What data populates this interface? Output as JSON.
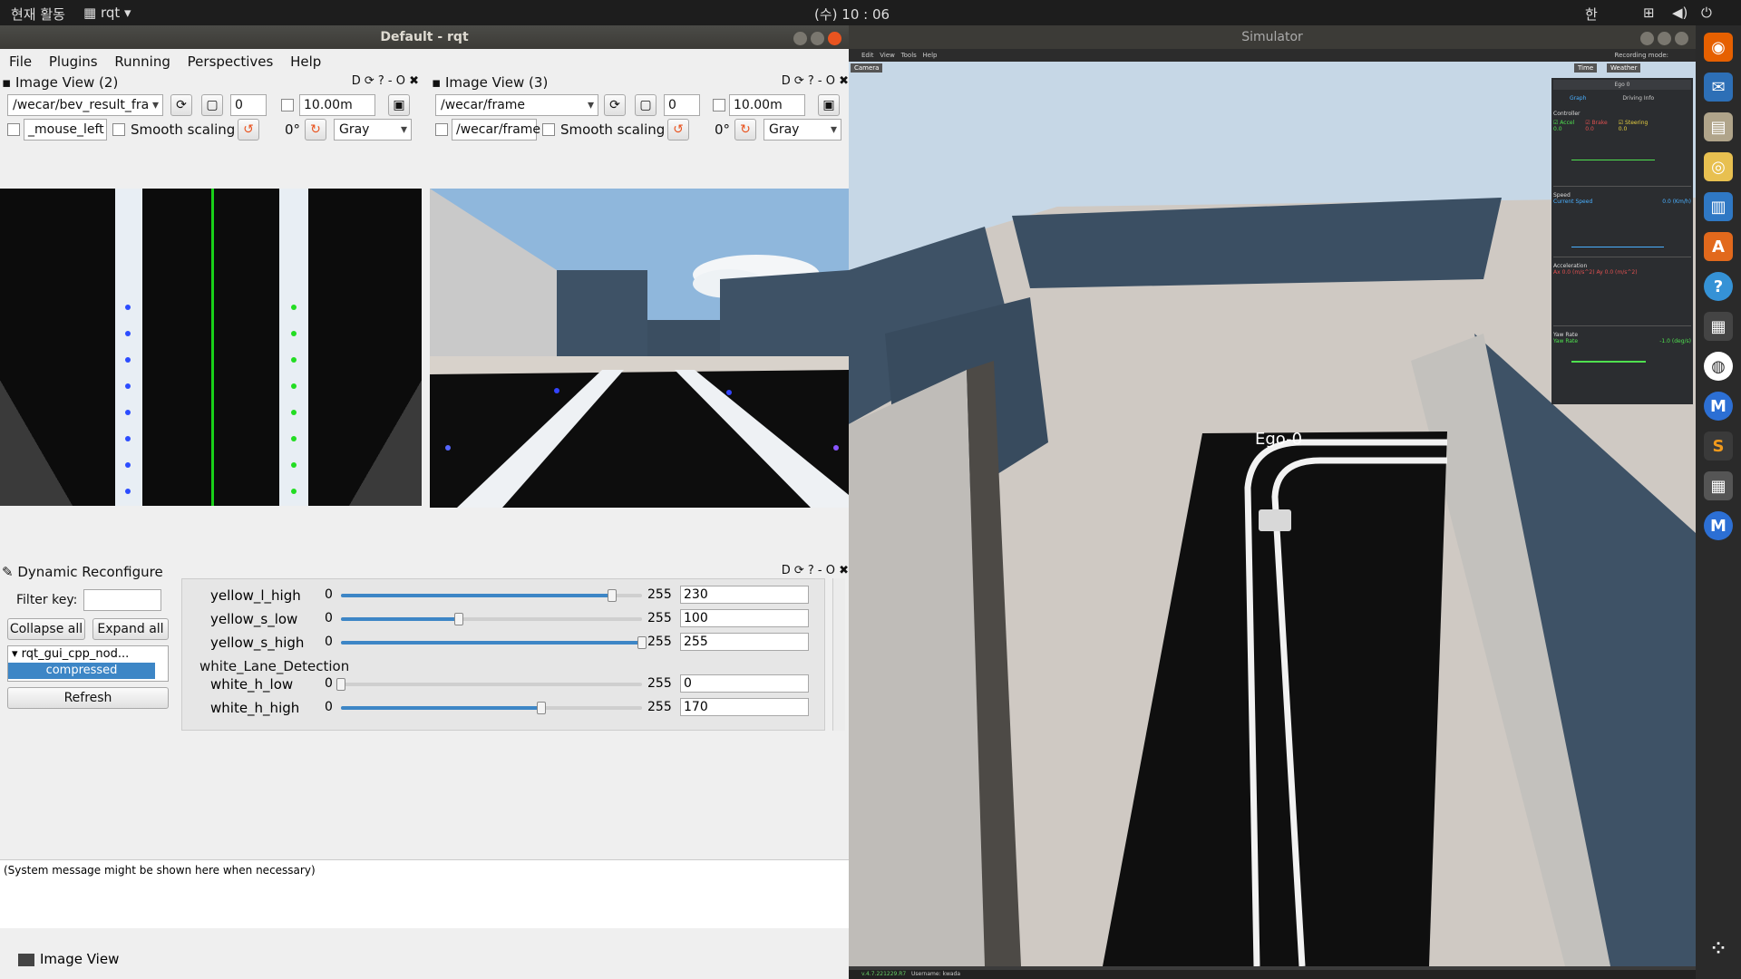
{
  "topbar": {
    "activities": "현재 활동",
    "app_menu": "rqt",
    "clock": "(수) 10 : 06",
    "input_method": "한"
  },
  "rqt_window": {
    "title": "Default - rqt",
    "menu": [
      "File",
      "Plugins",
      "Running",
      "Perspectives",
      "Help"
    ],
    "image_view_left": {
      "title": "Image View (2)",
      "tools": "D ⟳ ? - O ✖",
      "topic": "/wecar/bev_result_fra",
      "spin_value": "0",
      "distance": "10.00m",
      "mouse_topic": "_mouse_left",
      "smooth_label": "Smooth scaling",
      "rotation": "0°",
      "color_scheme": "Gray"
    },
    "image_view_right": {
      "title": "Image View (3)",
      "tools": "D ⟳ ? - O ✖",
      "topic": "/wecar/frame",
      "spin_value": "0",
      "distance": "10.00m",
      "mouse_topic": "/wecar/frame",
      "smooth_label": "Smooth scaling",
      "rotation": "0°",
      "color_scheme": "Gray"
    },
    "dynamic_reconfigure": {
      "title": "Dynamic Reconfigure",
      "tools": "D ⟳ ? - O ✖",
      "filter_label": "Filter key:",
      "collapse_all": "Collapse all",
      "expand_all": "Expand all",
      "tree_node": "rqt_gui_cpp_nod...",
      "tree_child": "compressed",
      "refresh": "Refresh",
      "section_label": "white_Lane_Detection",
      "params": [
        {
          "name": "yellow_l_high",
          "min": "0",
          "max": "255",
          "value": "230",
          "fraction": 0.902
        },
        {
          "name": "yellow_s_low",
          "min": "0",
          "max": "255",
          "value": "100",
          "fraction": 0.392
        },
        {
          "name": "yellow_s_high",
          "min": "0",
          "max": "255",
          "value": "255",
          "fraction": 1.0
        },
        {
          "name": "white_h_low",
          "min": "0",
          "max": "255",
          "value": "0",
          "fraction": 0.0
        },
        {
          "name": "white_h_high",
          "min": "0",
          "max": "255",
          "value": "170",
          "fraction": 0.667
        }
      ]
    },
    "system_message": "(System message might be shown here when necessary)",
    "bottom_tab": "Image View"
  },
  "simulator": {
    "title": "Simulator",
    "menu": [
      "Edit",
      "View",
      "Tools",
      "Help"
    ],
    "recording": "Recording mode:",
    "camera_btn": "Camera",
    "time_btn": "Time",
    "weather_btn": "Weather",
    "ego_label": "Ego-0",
    "footer_version": "v.4.7.221229.R7",
    "footer_user": "Username: kwada",
    "panel": {
      "ego_select": "Ego 0",
      "tabs": [
        "Graph",
        "Driving Info"
      ],
      "controller_label": "Controller",
      "controller_items": [
        {
          "name": "Accel",
          "value": "0.0",
          "color": "#4fe04f"
        },
        {
          "name": "Brake",
          "value": "0.0",
          "color": "#e05050"
        },
        {
          "name": "Steering",
          "value": "0.0",
          "color": "#e8d040"
        }
      ],
      "speed_label": "Speed",
      "speed_item": "Current Speed",
      "speed_value": "0.0 (Km/h)",
      "accel_label": "Acceleration",
      "ax_value": "0.0 (m/s^2)",
      "ay_value": "0.0 (m/s^2)",
      "yaw_label": "Yaw Rate",
      "yaw_item": "Yaw Rate",
      "yaw_value": "-1.0 (deg/s)"
    }
  },
  "colors": {
    "accent": "#3d86c6",
    "ubuntu_orange": "#e95420"
  }
}
